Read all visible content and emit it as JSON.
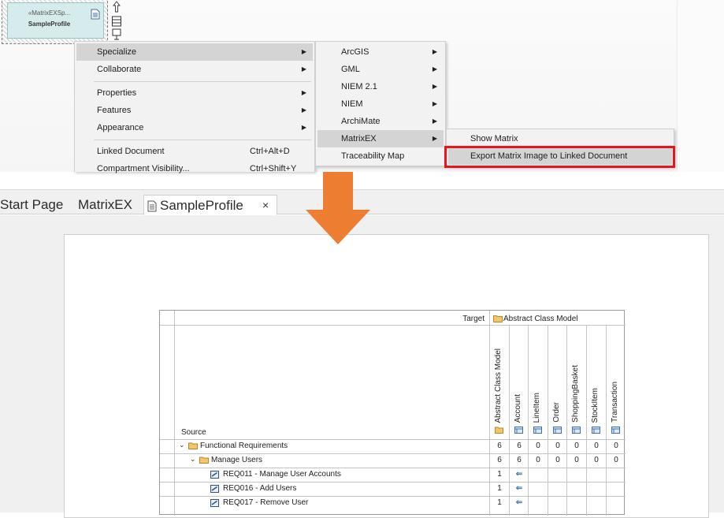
{
  "diagram_element": {
    "stereotype": "«MatrixEXSp...",
    "name": "SampleProfile"
  },
  "context_menu": {
    "items": [
      {
        "label": "Specialize",
        "has_submenu": true,
        "highlighted": true
      },
      {
        "label": "Collaborate",
        "has_submenu": true
      },
      {
        "label": "Properties",
        "has_submenu": true
      },
      {
        "label": "Features",
        "has_submenu": true
      },
      {
        "label": "Appearance",
        "has_submenu": true
      },
      {
        "label": "Linked Document",
        "shortcut": "Ctrl+Alt+D"
      },
      {
        "label": "Compartment Visibility...",
        "shortcut": "Ctrl+Shift+Y"
      }
    ]
  },
  "specialize_menu": {
    "items": [
      {
        "label": "ArcGIS",
        "has_submenu": true
      },
      {
        "label": "GML",
        "has_submenu": true
      },
      {
        "label": "NIEM 2.1",
        "has_submenu": true
      },
      {
        "label": "NIEM",
        "has_submenu": true
      },
      {
        "label": "ArchiMate",
        "has_submenu": true
      },
      {
        "label": "MatrixEX",
        "has_submenu": true,
        "highlighted": true
      },
      {
        "label": "Traceability Map",
        "has_submenu": false
      }
    ]
  },
  "matrixex_menu": {
    "items": [
      {
        "label": "Show Matrix"
      },
      {
        "label": "Export Matrix Image to Linked Document",
        "highlighted": true
      }
    ]
  },
  "tabs": {
    "start_page": "Start Page",
    "matrixex": "MatrixEX",
    "active": "SampleProfile",
    "close_glyph": "×"
  },
  "matrix": {
    "target_label": "Target",
    "target_model": "Abstract Class Model",
    "source_label": "Source",
    "columns": [
      "Abstract Class Model",
      "Account",
      "LineItem",
      "Order",
      "ShoppingBasket",
      "StockItem",
      "Transaction"
    ],
    "rows": [
      {
        "label": "Functional Requirements",
        "level": 0,
        "kind": "folder",
        "values": [
          "6",
          "6",
          "0",
          "0",
          "0",
          "0",
          "0"
        ]
      },
      {
        "label": "Manage Users",
        "level": 1,
        "kind": "folder",
        "values": [
          "6",
          "6",
          "0",
          "0",
          "0",
          "0",
          "0"
        ]
      },
      {
        "label": "REQ011 - Manage User Accounts",
        "level": 2,
        "kind": "req",
        "values": [
          "1",
          "⇐",
          "",
          "",
          "",
          "",
          ""
        ]
      },
      {
        "label": "REQ016 - Add Users",
        "level": 2,
        "kind": "req",
        "values": [
          "1",
          "⇐",
          "",
          "",
          "",
          "",
          ""
        ]
      },
      {
        "label": "REQ017 - Remove User",
        "level": 2,
        "kind": "req",
        "values": [
          "1",
          "⇐",
          "",
          "",
          "",
          "",
          ""
        ]
      }
    ]
  },
  "colors": {
    "highlight_box": "#e8141c",
    "arrow": "#ed7d31",
    "menu_highlight": "#d4d4d4"
  }
}
